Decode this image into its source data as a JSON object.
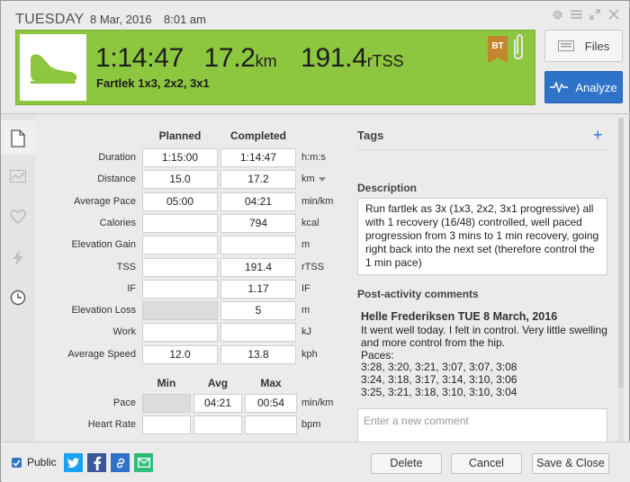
{
  "header": {
    "day": "TUESDAY",
    "date": "8 Mar, 2016",
    "time": "8:01 am",
    "duration": "1:14:47",
    "distance": "17.2",
    "distance_unit": "km",
    "tss": "191.4",
    "tss_unit": "rTSS",
    "workout_name": "Fartlek 1x3, 2x2, 3x1",
    "badge": "BT",
    "files_label": "Files",
    "analyze_label": "Analyze",
    "accent_green": "#8dc63f",
    "accent_blue": "#2f73c9"
  },
  "window_icons": [
    "gear-icon",
    "menu-icon",
    "expand-icon",
    "close-icon"
  ],
  "rail_icons": [
    "document-icon",
    "chart-icon",
    "heart-icon",
    "lightning-icon",
    "clock-icon"
  ],
  "form": {
    "planned_header": "Planned",
    "completed_header": "Completed",
    "rows": [
      {
        "label": "Duration",
        "planned": "1:15:00",
        "completed": "1:14:47",
        "unit": "h:m:s"
      },
      {
        "label": "Distance",
        "planned": "15.0",
        "completed": "17.2",
        "unit": "km"
      },
      {
        "label": "Average Pace",
        "planned": "05:00",
        "completed": "04:21",
        "unit": "min/km"
      },
      {
        "label": "Calories",
        "planned": "",
        "completed": "794",
        "unit": "kcal"
      },
      {
        "label": "Elevation Gain",
        "planned": "",
        "completed": "",
        "unit": "m"
      },
      {
        "label": "TSS",
        "planned": "",
        "completed": "191.4",
        "unit": "rTSS"
      },
      {
        "label": "IF",
        "planned": "",
        "completed": "1.17",
        "unit": "IF"
      },
      {
        "label": "Elevation Loss",
        "planned": "",
        "completed": "5",
        "unit": "m"
      },
      {
        "label": "Work",
        "planned": "",
        "completed": "",
        "unit": "kJ"
      },
      {
        "label": "Average Speed",
        "planned": "12.0",
        "completed": "13.8",
        "unit": "kph"
      }
    ],
    "stats_headers": [
      "Min",
      "Avg",
      "Max"
    ],
    "stats_rows": [
      {
        "label": "Pace",
        "min": "",
        "avg": "04:21",
        "max": "00:54",
        "unit": "min/km"
      },
      {
        "label": "Heart Rate",
        "min": "",
        "avg": "",
        "max": "",
        "unit": "bpm"
      }
    ]
  },
  "right": {
    "tags_title": "Tags",
    "tags_add": "+",
    "description_title": "Description",
    "description": "Run fartlek as 3x (1x3, 2x2, 3x1 progressive) all with 1 recovery (16/48) controlled, well paced progression from 3 mins to 1 min recovery, going right back into the next set (therefore control the 1 min pace)",
    "comments_title": "Post-activity comments",
    "comment_author": "Helle Frederiksen  TUE 8 March, 2016",
    "comment_text": "It went well today. I felt in control. Very little swelling and more control from the hip.\nPaces:\n3:28, 3:20, 3:21, 3:07, 3:07, 3:08\n3:24, 3:18, 3:17, 3:14, 3:10, 3:06\n3:25, 3:21, 3:18, 3:10, 3:10, 3:04",
    "new_comment_placeholder": "Enter a new comment"
  },
  "footer": {
    "public_label": "Public",
    "share_icons": [
      "twitter-icon",
      "facebook-icon",
      "link-icon",
      "email-icon"
    ],
    "delete_label": "Delete",
    "cancel_label": "Cancel",
    "save_close_label": "Save & Close"
  }
}
